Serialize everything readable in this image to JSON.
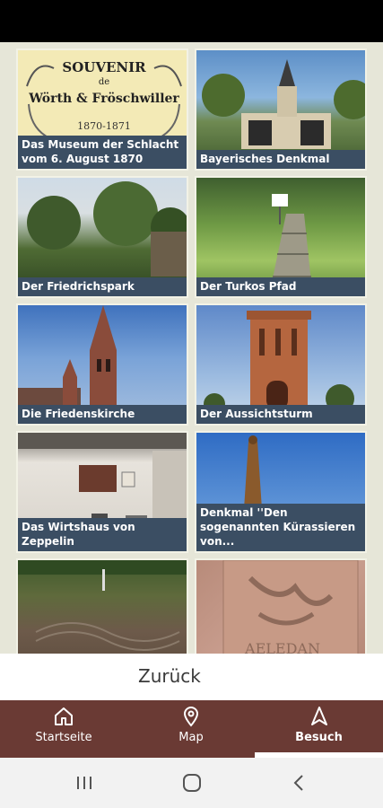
{
  "tiles": [
    {
      "caption": "Das Museum der Schlacht vom 6. August 1870",
      "image": "souvenir-poster",
      "souvenir": {
        "line1": "SOUVENIR",
        "line2": "de",
        "line3": "Wörth & Fröschwiller",
        "line4": "1870-1871"
      }
    },
    {
      "caption": "Bayerisches Denkmal",
      "image": "monument-with-statue"
    },
    {
      "caption": "Der Friedrichspark",
      "image": "park-trees"
    },
    {
      "caption": "Der Turkos Pfad",
      "image": "green-path-steps"
    },
    {
      "caption": "Die Friedenskirche",
      "image": "church-towers"
    },
    {
      "caption": "Der Aussichtsturm",
      "image": "brick-tower"
    },
    {
      "caption": "Das Wirtshaus von Zeppelin",
      "image": "white-house-plaque"
    },
    {
      "caption": "Denkmal ''Den sogenannten Kürassieren von...",
      "image": "obelisk-monument"
    },
    {
      "caption": "",
      "image": "grave-field"
    },
    {
      "caption": "",
      "image": "stone-relief",
      "relief_text": "AELEDAN"
    }
  ],
  "back": {
    "label": "Zurück"
  },
  "nav": [
    {
      "label": "Startseite",
      "icon": "home-icon"
    },
    {
      "label": "Map",
      "icon": "map-pin-icon"
    },
    {
      "label": "Besuch",
      "icon": "navigation-arrow-icon",
      "active": true
    }
  ],
  "colors": {
    "nav_bg": "#6a3a34",
    "caption_bg": "#3b4e63",
    "page_bg": "#e6e6d8"
  }
}
